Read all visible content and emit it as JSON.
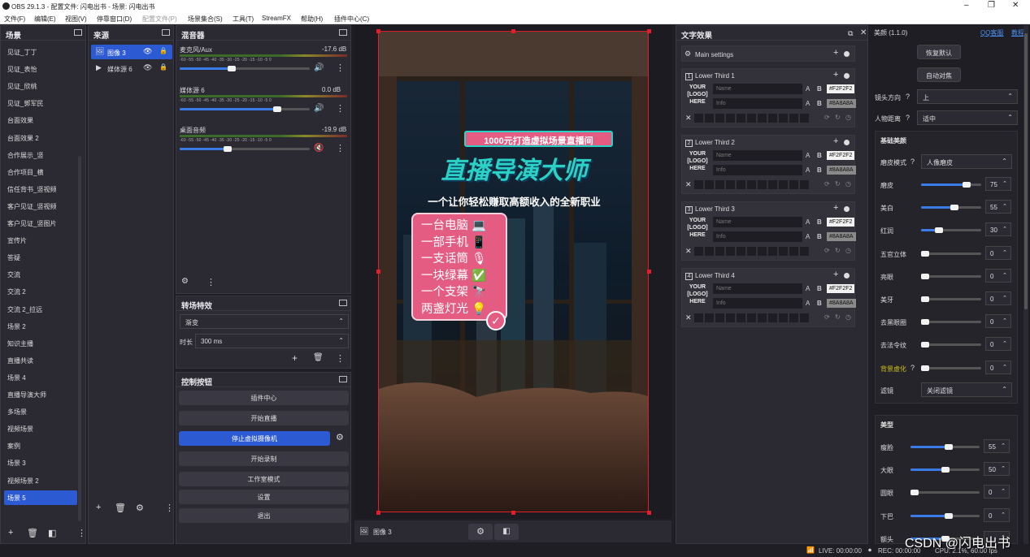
{
  "window": {
    "title": "OBS 29.1.3 - 配置文件: 闪电出书 - 场景: 闪电出书"
  },
  "menu": [
    "文件(F)",
    "编辑(E)",
    "视图(V)",
    "停靠窗口(D)",
    "配置文件(P)",
    "场景集合(S)",
    "工具(T)",
    "StreamFX",
    "帮助(H)",
    "插件中心(C)"
  ],
  "scenes": {
    "title": "场景",
    "items": [
      "见证_丁丁",
      "见证_表怡",
      "见证_欣桃",
      "见证_郭军民",
      "台面效果",
      "台面效果 2",
      "合作展示_竖",
      "合作项目_横",
      "信任背书_竖视频",
      "客户见证_竖视频",
      "客户见证_竖图片",
      "宣传片",
      "答疑",
      "交流",
      "交流 2",
      "交流 2_拉远",
      "场景 2",
      "知识主播",
      "直播共读",
      "场景 4",
      "直播导演大师",
      "多场景",
      "视频场景",
      "案例",
      "场景 3",
      "视频场景 2",
      "场景 5"
    ],
    "selected": "场景 5"
  },
  "sources": {
    "title": "来源",
    "items": [
      {
        "name": "图像 3",
        "selected": true
      },
      {
        "name": "媒体源 6",
        "selected": false
      }
    ]
  },
  "mixer": {
    "title": "混音器",
    "ticks": "-60 -55 -50 -45 -40 -35 -30 -25 -20 -15 -10 -5 0",
    "channels": [
      {
        "name": "麦克风/Aux",
        "db": "-17.6 dB",
        "level": 0.4,
        "muted": false
      },
      {
        "name": "媒体源 6",
        "db": "0.0 dB",
        "level": 0.75,
        "muted": false
      },
      {
        "name": "桌面音频",
        "db": "-19.9 dB",
        "level": 0.37,
        "muted": true
      }
    ]
  },
  "transitions": {
    "title": "转场特效",
    "selected": "渐变",
    "duration_label": "时长",
    "duration": "300 ms"
  },
  "controls": {
    "title": "控制按钮",
    "buttons": [
      "插件中心",
      "开始直播",
      "停止虚拟摄像机",
      "开始录制",
      "工作室模式",
      "设置",
      "退出"
    ]
  },
  "canvas": {
    "banner": "1000元打造虚拟场景直播间",
    "headline": "直播导演大师",
    "subtitle": "一个让你轻松赚取高额收入的全新职业",
    "list": [
      "一台电脑 💻",
      "一部手机 📱",
      "一支话筒 🎙",
      "一块绿幕 ✅",
      "一个支架 🔭",
      "两盏灯光 💡"
    ],
    "colors": {
      "accent_red": "#e01f2a",
      "pink": "#e55c83",
      "teal": "#2ad1c4"
    }
  },
  "preview_bar": {
    "source": "图像 3"
  },
  "text_effects": {
    "title": "文字效果",
    "main_settings": "Main settings",
    "lower_thirds": [
      {
        "index": "1",
        "label": "Lower Third 1",
        "name_ph": "Name",
        "info_ph": "Info",
        "color1": "#F2F2F2",
        "color2": "#8A8A8A"
      },
      {
        "index": "2",
        "label": "Lower Third 2",
        "name_ph": "Name",
        "info_ph": "Info",
        "color1": "#F2F2F2",
        "color2": "#8A8A8A"
      },
      {
        "index": "3",
        "label": "Lower Third 3",
        "name_ph": "Name",
        "info_ph": "Info",
        "color1": "#F2F2F2",
        "color2": "#8A8A8A"
      },
      {
        "index": "4",
        "label": "Lower Third 4",
        "name_ph": "Name",
        "info_ph": "Info",
        "color1": "#F2F2F2",
        "color2": "#8A8A8A"
      }
    ],
    "logo_lines": [
      "YOUR",
      "[LOGO]",
      "HERE"
    ]
  },
  "beauty": {
    "title": "美颜 (1.1.0)",
    "link_qq": "QQ客服",
    "link_tutorial": "教程",
    "btn_reset": "恢复默认",
    "btn_focus": "自动对焦",
    "cam_dir_label": "镜头方向",
    "cam_dir": "上",
    "distance_label": "人物距离",
    "distance": "适中",
    "basic_title": "基础美颜",
    "skin_mode_label": "磨皮模式",
    "skin_mode": "人像磨皮",
    "sliders": [
      {
        "label": "磨皮",
        "value": "75",
        "level": 0.75
      },
      {
        "label": "美白",
        "value": "55",
        "level": 0.55
      },
      {
        "label": "红润",
        "value": "30",
        "level": 0.3
      },
      {
        "label": "五官立体",
        "value": "0",
        "level": 0
      },
      {
        "label": "亮眼",
        "value": "0",
        "level": 0
      },
      {
        "label": "美牙",
        "value": "0",
        "level": 0
      },
      {
        "label": "去黑眼圈",
        "value": "0",
        "level": 0
      },
      {
        "label": "去法令纹",
        "value": "0",
        "level": 0
      },
      {
        "label": "背景虚化",
        "value": "0",
        "level": 0
      }
    ],
    "filter_label": "滤镜",
    "filter": "关闭滤镜",
    "shape_title": "美型",
    "shape_sliders": [
      {
        "label": "瘦脸",
        "value": "55",
        "level": 0.55
      },
      {
        "label": "大眼",
        "value": "50",
        "level": 0.5
      },
      {
        "label": "圆眼",
        "value": "0",
        "level": 0
      },
      {
        "label": "下巴",
        "value": "0",
        "level": 0.55
      },
      {
        "label": "额头",
        "value": "",
        "level": 0.5
      }
    ]
  },
  "status": {
    "live": "LIVE: 00:00:00",
    "rec": "REC: 00:00:00",
    "cpu": "CPU: 2.1%, 60.00 fps"
  },
  "watermark": "CSDN @闪电出书"
}
